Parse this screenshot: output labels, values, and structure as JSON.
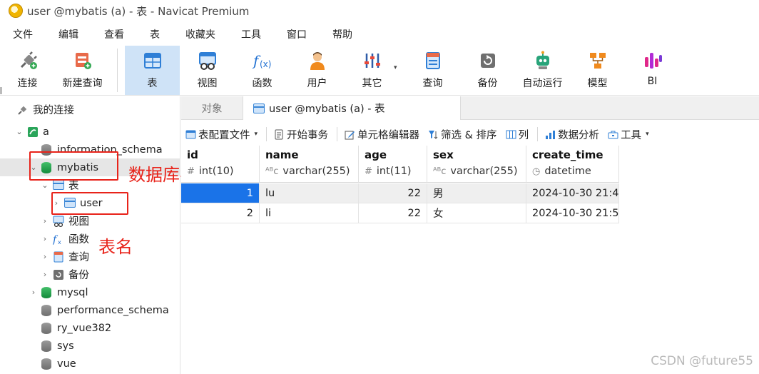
{
  "window": {
    "title": "user @mybatis (a) - 表 - Navicat Premium"
  },
  "menu": [
    "文件",
    "编辑",
    "查看",
    "表",
    "收藏夹",
    "工具",
    "窗口",
    "帮助"
  ],
  "toolbar": {
    "connect": "连接",
    "new_query": "新建查询",
    "table": "表",
    "view": "视图",
    "function": "函数",
    "user": "用户",
    "other": "其它",
    "query": "查询",
    "backup": "备份",
    "automation": "自动运行",
    "model": "模型",
    "bi": "BI"
  },
  "tree": {
    "root": "我的连接",
    "connection": "a",
    "databases": {
      "information_schema": "information_schema",
      "mybatis": "mybatis",
      "tables_folder": "表",
      "user_table": "user",
      "views": "视图",
      "functions": "函数",
      "queries": "查询",
      "backups": "备份",
      "mysql": "mysql",
      "performance_schema": "performance_schema",
      "ry_vue382": "ry_vue382",
      "sys": "sys",
      "vue": "vue"
    }
  },
  "annotations": {
    "db_name": "数据库名",
    "table_name": "表名"
  },
  "tabs": {
    "objects": "对象",
    "active": "user @mybatis (a) - 表"
  },
  "subtoolbar": {
    "table_config": "表配置文件",
    "begin_tx": "开始事务",
    "cell_editor": "单元格编辑器",
    "filter_sort": "筛选 & 排序",
    "columns": "列",
    "data_analysis": "数据分析",
    "tools": "工具"
  },
  "grid": {
    "columns": [
      {
        "name": "id",
        "type": "int(10)",
        "sym": "#"
      },
      {
        "name": "name",
        "type": "varchar(255)",
        "sym": "ᴬᴮc"
      },
      {
        "name": "age",
        "type": "int(11)",
        "sym": "#"
      },
      {
        "name": "sex",
        "type": "varchar(255)",
        "sym": "ᴬᴮc"
      },
      {
        "name": "create_time",
        "type": "datetime",
        "sym": "◷"
      }
    ],
    "rows": [
      {
        "id": "1",
        "name": "lu",
        "age": "22",
        "sex": "男",
        "create_time": "2024-10-30 21:4"
      },
      {
        "id": "2",
        "name": "li",
        "age": "22",
        "sex": "女",
        "create_time": "2024-10-30 21:5"
      }
    ]
  },
  "watermark": "CSDN @future55"
}
